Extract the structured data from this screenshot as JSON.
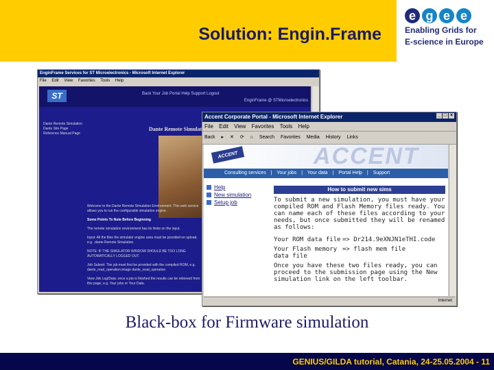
{
  "slide": {
    "title": "Solution: Engin.Frame",
    "caption": "Black-box for Firmware simulation",
    "footer": "GENIUS/GILDA tutorial, Catania, 24-25.05.2004  - 11"
  },
  "logo": {
    "letters": [
      "e",
      "g",
      "e",
      "e"
    ],
    "line1": "Enabling Grids for",
    "line2": "E-science in Europe"
  },
  "back_window": {
    "title": "EnginFrame Services for ST Microelectronics - Microsoft Internet Explorer",
    "menu": [
      "File",
      "Edit",
      "View",
      "Favorites",
      "Tools",
      "Help"
    ],
    "top_links": "Back   Your Job   Portal Help   Support   Logout",
    "company": "EnginFrame @ STMicroelectronics",
    "side_links": [
      "Dante Remote Simulation",
      "Dante Site Page",
      "Reference Manual Page"
    ],
    "page_title": "Dante Remote Simulation",
    "text_intro": "Welcome to the Dante Remote Simulation Environment. This web service allows you to run the configurable simulation engine.",
    "text_heading": "Some Points To Note Before Beginning",
    "text_1": "The remote simulation environment has its limits on the input.",
    "text_2": "Input: All the files the simulator engine uses must be provided on upload, e.g. .dante Remote Simulation.",
    "text_3": "NOTE: IF THE SIMULATOR WINDOW SHOULD BE TOO LONG AUTOMATICALLY LOGGED OUT.",
    "text_4": "Job Submit: The job must first be provided with the compiled ROM, e.g. dante_read_operation.image dante_read_operation",
    "text_5": "View Job Log/Data: once a job is finished the results can be retrieved from this page, e.g. Your jobs or Your Data."
  },
  "front_window": {
    "title": "Accent Corporate Portal - Microsoft Internet Explorer",
    "menu": [
      "File",
      "Edit",
      "View",
      "Favorites",
      "Tools",
      "Help"
    ],
    "toolbar": [
      "Back",
      "▸",
      "✕",
      "⟳",
      "⌂",
      "Search",
      "Favorites",
      "Media",
      "History",
      "Links"
    ],
    "accent_logo": "ACCENT",
    "accent_word": "ACCENT",
    "navbar": [
      "Consulting services",
      "Your jobs",
      "Your data",
      "Portal Help",
      "Support"
    ],
    "nav_items": [
      "Help",
      "New simulation",
      "Setup job"
    ],
    "howto_header": "How to submit new sims",
    "para1": "To submit a new simulation, you must have your compiled ROM and Flash Memory files ready. You can name each of these files according to your needs, but once submitted they will be renamed as follows:",
    "field1_label": "Your ROM data file",
    "field1_value": "=> Dr214.9eXNJN1eTHI.code",
    "field2_label": "Your Flash memory data file",
    "field2_value": "=> flash mem file",
    "para2": "Once you have these two files ready, you can proceed to the submission page using the New simulation link on the left toolbar.",
    "status_right": "Internet"
  }
}
